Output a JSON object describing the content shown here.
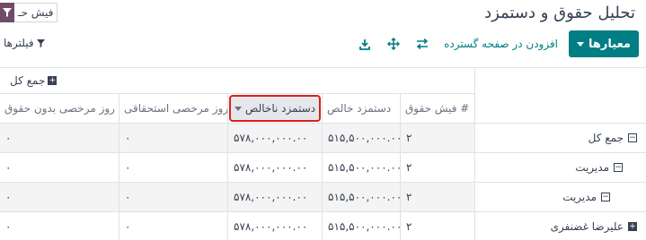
{
  "page": {
    "title": "تحلیل حقوق و دستمزد"
  },
  "search": {
    "facet_label": "فیش حـ"
  },
  "toolbar": {
    "measures_label": "معیارها",
    "insert_label": "افزودن در صفحه گسترده",
    "filters_label": "فیلترها",
    "icons": [
      "flip-axis-icon",
      "expand-all-icon",
      "download-icon"
    ]
  },
  "table": {
    "group_header": "جمع کل",
    "columns": [
      "# فیش حقوق",
      "دستمزد خالص",
      "دستمزد ناخالص",
      "روز مرخصی استحقاقی",
      "روز مرخصی بدون حقوق"
    ],
    "sorted_column_index": 2,
    "rows": [
      {
        "label": "جمع کل",
        "toggle": "minus",
        "values": [
          "۲",
          "۵۱۵,۵۰۰,۰۰۰.۰۰",
          "۵۷۸,۰۰۰,۰۰۰.۰۰",
          "۰",
          "۰"
        ]
      },
      {
        "label": "مدیریت",
        "toggle": "minus",
        "values": [
          "۲",
          "۵۱۵,۵۰۰,۰۰۰.۰۰",
          "۵۷۸,۰۰۰,۰۰۰.۰۰",
          "۰",
          "۰"
        ]
      },
      {
        "label": "مدیریت",
        "toggle": "minus",
        "values": [
          "۲",
          "۵۱۵,۵۰۰,۰۰۰.۰۰",
          "۵۷۸,۰۰۰,۰۰۰.۰۰",
          "۰",
          "۰"
        ]
      },
      {
        "label": "علیرضا غضنفری",
        "toggle": "plus",
        "values": [
          "۲",
          "۵۱۵,۵۰۰,۰۰۰.۰۰",
          "۵۷۸,۰۰۰,۰۰۰.۰۰",
          "۰",
          "۰"
        ]
      }
    ]
  },
  "colors": {
    "primary": "#017e84",
    "brand": "#714b67",
    "sort_highlight": "#d9201e"
  }
}
